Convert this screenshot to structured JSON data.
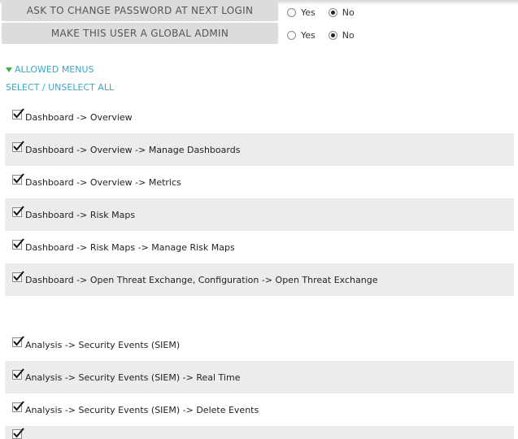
{
  "options": [
    {
      "label": "ASK TO CHANGE PASSWORD AT NEXT LOGIN",
      "yes": "Yes",
      "no": "No",
      "selected": "no"
    },
    {
      "label": "MAKE THIS USER A GLOBAL ADMIN",
      "yes": "Yes",
      "no": "No",
      "selected": "no"
    }
  ],
  "allowed_menus": {
    "title": "ALLOWED MENUS",
    "select_all": "SELECT / UNSELECT ALL",
    "items": [
      {
        "label": "Dashboard -> Overview",
        "checked": true
      },
      {
        "label": "Dashboard -> Overview -> Manage Dashboards",
        "checked": true
      },
      {
        "label": "Dashboard -> Overview -> Metrics",
        "checked": true
      },
      {
        "label": "Dashboard -> Risk Maps",
        "checked": true
      },
      {
        "label": "Dashboard -> Risk Maps -> Manage Risk Maps",
        "checked": true
      },
      {
        "label": "Dashboard -> Open Threat Exchange, Configuration -> Open Threat Exchange",
        "checked": true
      },
      {
        "label": "Analysis -> Security Events (SIEM)",
        "checked": true
      },
      {
        "label": "Analysis -> Security Events (SIEM) -> Real Time",
        "checked": true
      },
      {
        "label": "Analysis -> Security Events (SIEM) -> Delete Events",
        "checked": true
      },
      {
        "label": "",
        "checked": true
      }
    ]
  }
}
